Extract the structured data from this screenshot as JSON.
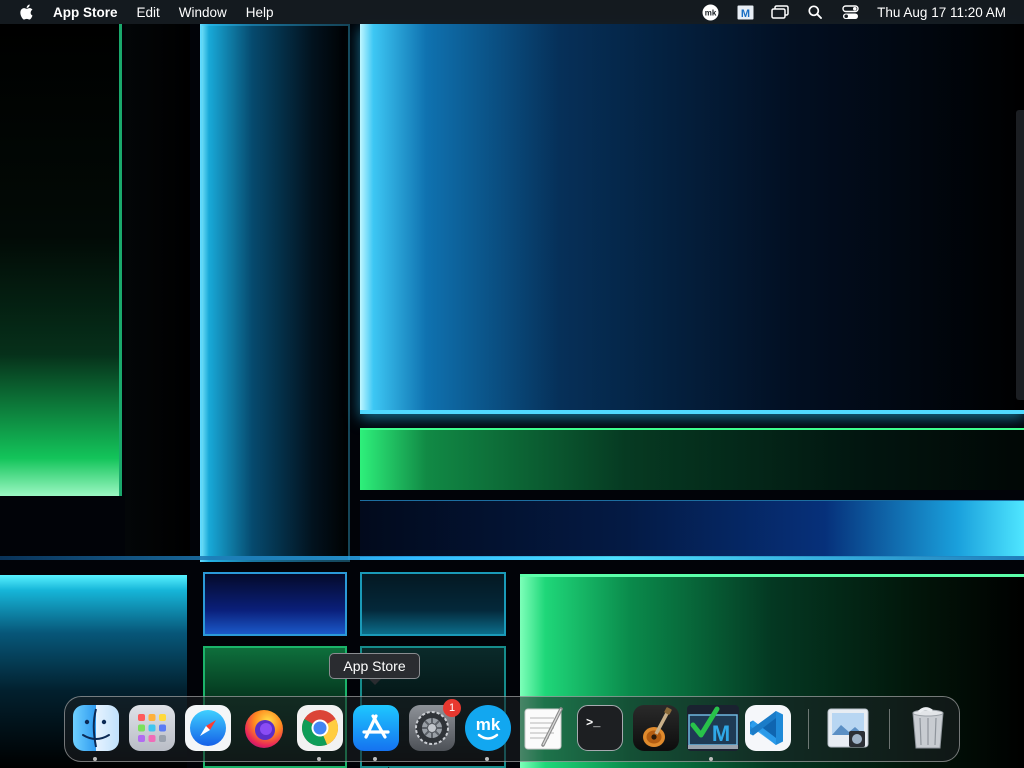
{
  "menubar": {
    "app_name": "App Store",
    "menus": [
      "Edit",
      "Window",
      "Help"
    ],
    "status_icons": [
      "mk-icon",
      "m-app-icon",
      "window-switcher-icon",
      "spotlight-search-icon",
      "control-center-icon"
    ],
    "clock": "Thu Aug 17  11:20 AM"
  },
  "tooltip": {
    "text": "App Store"
  },
  "dock": {
    "items": [
      {
        "name": "Finder",
        "running": true
      },
      {
        "name": "Launchpad",
        "running": false
      },
      {
        "name": "Safari",
        "running": false
      },
      {
        "name": "Firefox",
        "running": false
      },
      {
        "name": "Google Chrome",
        "running": true
      },
      {
        "name": "App Store",
        "running": true
      },
      {
        "name": "System Settings",
        "running": false,
        "badge": "1"
      },
      {
        "name": "mk app",
        "running": true
      },
      {
        "name": "TextEdit",
        "running": false
      },
      {
        "name": "Terminal",
        "running": false
      },
      {
        "name": "GarageBand",
        "running": false
      },
      {
        "name": "Checkmark M app",
        "running": true
      },
      {
        "name": "Visual Studio Code",
        "running": false
      },
      {
        "name": "Preview",
        "running": false
      },
      {
        "name": "Trash",
        "running": false
      }
    ]
  },
  "colors": {
    "accent_cyan": "#2fd3ff",
    "accent_green": "#22e06a",
    "menubar_bg": "#161c22",
    "badge_red": "#e8382f"
  }
}
